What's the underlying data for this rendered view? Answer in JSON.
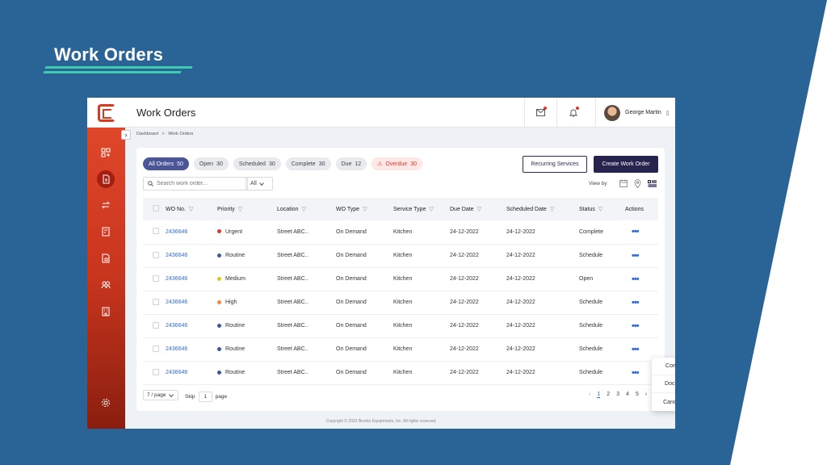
{
  "hero": {
    "title": "Work Orders"
  },
  "topbar": {
    "title": "Work Orders",
    "user_name": "George Martin",
    "user_caret": "▯"
  },
  "breadcrumb": {
    "home": "Dashboard",
    "separator": ">",
    "current": "Work Orders"
  },
  "chips": [
    {
      "label": "All Orders",
      "count": "50"
    },
    {
      "label": "Open",
      "count": "30"
    },
    {
      "label": "Scheduled",
      "count": "30"
    },
    {
      "label": "Complete",
      "count": "30"
    },
    {
      "label": "Due",
      "count": "12"
    },
    {
      "label": "Overdue",
      "count": "30"
    }
  ],
  "actions": {
    "recurring": "Recurring Services",
    "create": "Create Work Order"
  },
  "search": {
    "placeholder": "Search work order...",
    "filter_value": "All"
  },
  "view_by": "View by",
  "table": {
    "headers": [
      "WO No.",
      "Priority",
      "Location",
      "WO Type",
      "Service Type",
      "Due Date",
      "Scheduled Date",
      "Status",
      "Actions"
    ],
    "rows": [
      {
        "wo": "2436646",
        "priority": "Urgent",
        "pcolor": "#e0352b",
        "location": "Street ABC..",
        "type": "On Demand",
        "service": "Kitchen",
        "due": "24-12-2022",
        "scheduled": "24-12-2022",
        "status": "Complete"
      },
      {
        "wo": "2436646",
        "priority": "Routine",
        "pcolor": "#3a5a9e",
        "location": "Street ABC..",
        "type": "On Demand",
        "service": "Kitchen",
        "due": "24-12-2022",
        "scheduled": "24-12-2022",
        "status": "Schedule"
      },
      {
        "wo": "2436646",
        "priority": "Medium",
        "pcolor": "#e8c51c",
        "location": "Street ABC..",
        "type": "On Demand",
        "service": "Kitchen",
        "due": "24-12-2022",
        "scheduled": "24-12-2022",
        "status": "Open"
      },
      {
        "wo": "2436646",
        "priority": "High",
        "pcolor": "#ef8c3a",
        "location": "Street ABC..",
        "type": "On Demand",
        "service": "Kitchen",
        "due": "24-12-2022",
        "scheduled": "24-12-2022",
        "status": "Schedule"
      },
      {
        "wo": "2436646",
        "priority": "Routine",
        "pcolor": "#3a5a9e",
        "location": "Street ABC..",
        "type": "On Demand",
        "service": "Kitchen",
        "due": "24-12-2022",
        "scheduled": "24-12-2022",
        "status": "Schedule"
      },
      {
        "wo": "2436646",
        "priority": "Routine",
        "pcolor": "#3a5a9e",
        "location": "Street ABC..",
        "type": "On Demand",
        "service": "Kitchen",
        "due": "24-12-2022",
        "scheduled": "24-12-2022",
        "status": "Schedule"
      },
      {
        "wo": "2436646",
        "priority": "Routine",
        "pcolor": "#3a5a9e",
        "location": "Street ABC..",
        "type": "On Demand",
        "service": "Kitchen",
        "due": "24-12-2022",
        "scheduled": "24-12-2022",
        "status": "Schedule"
      }
    ]
  },
  "action_menu": [
    "Complete",
    "Document",
    "Cancel WO"
  ],
  "pagination": {
    "per_page": "7 / page",
    "skip_label": "Skip",
    "skip_value": "1",
    "page_label": "page",
    "pages": [
      "1",
      "2",
      "3",
      "4",
      "5"
    ],
    "prev": "‹",
    "next": "›"
  },
  "footer": "Copyright © 2022 Brooks Equipments, Inc. All rights reserved.",
  "colors": {
    "brand_red": "#e44a2c",
    "navy": "#26234f",
    "link": "#2e6bd6",
    "background": "#2a6496"
  }
}
